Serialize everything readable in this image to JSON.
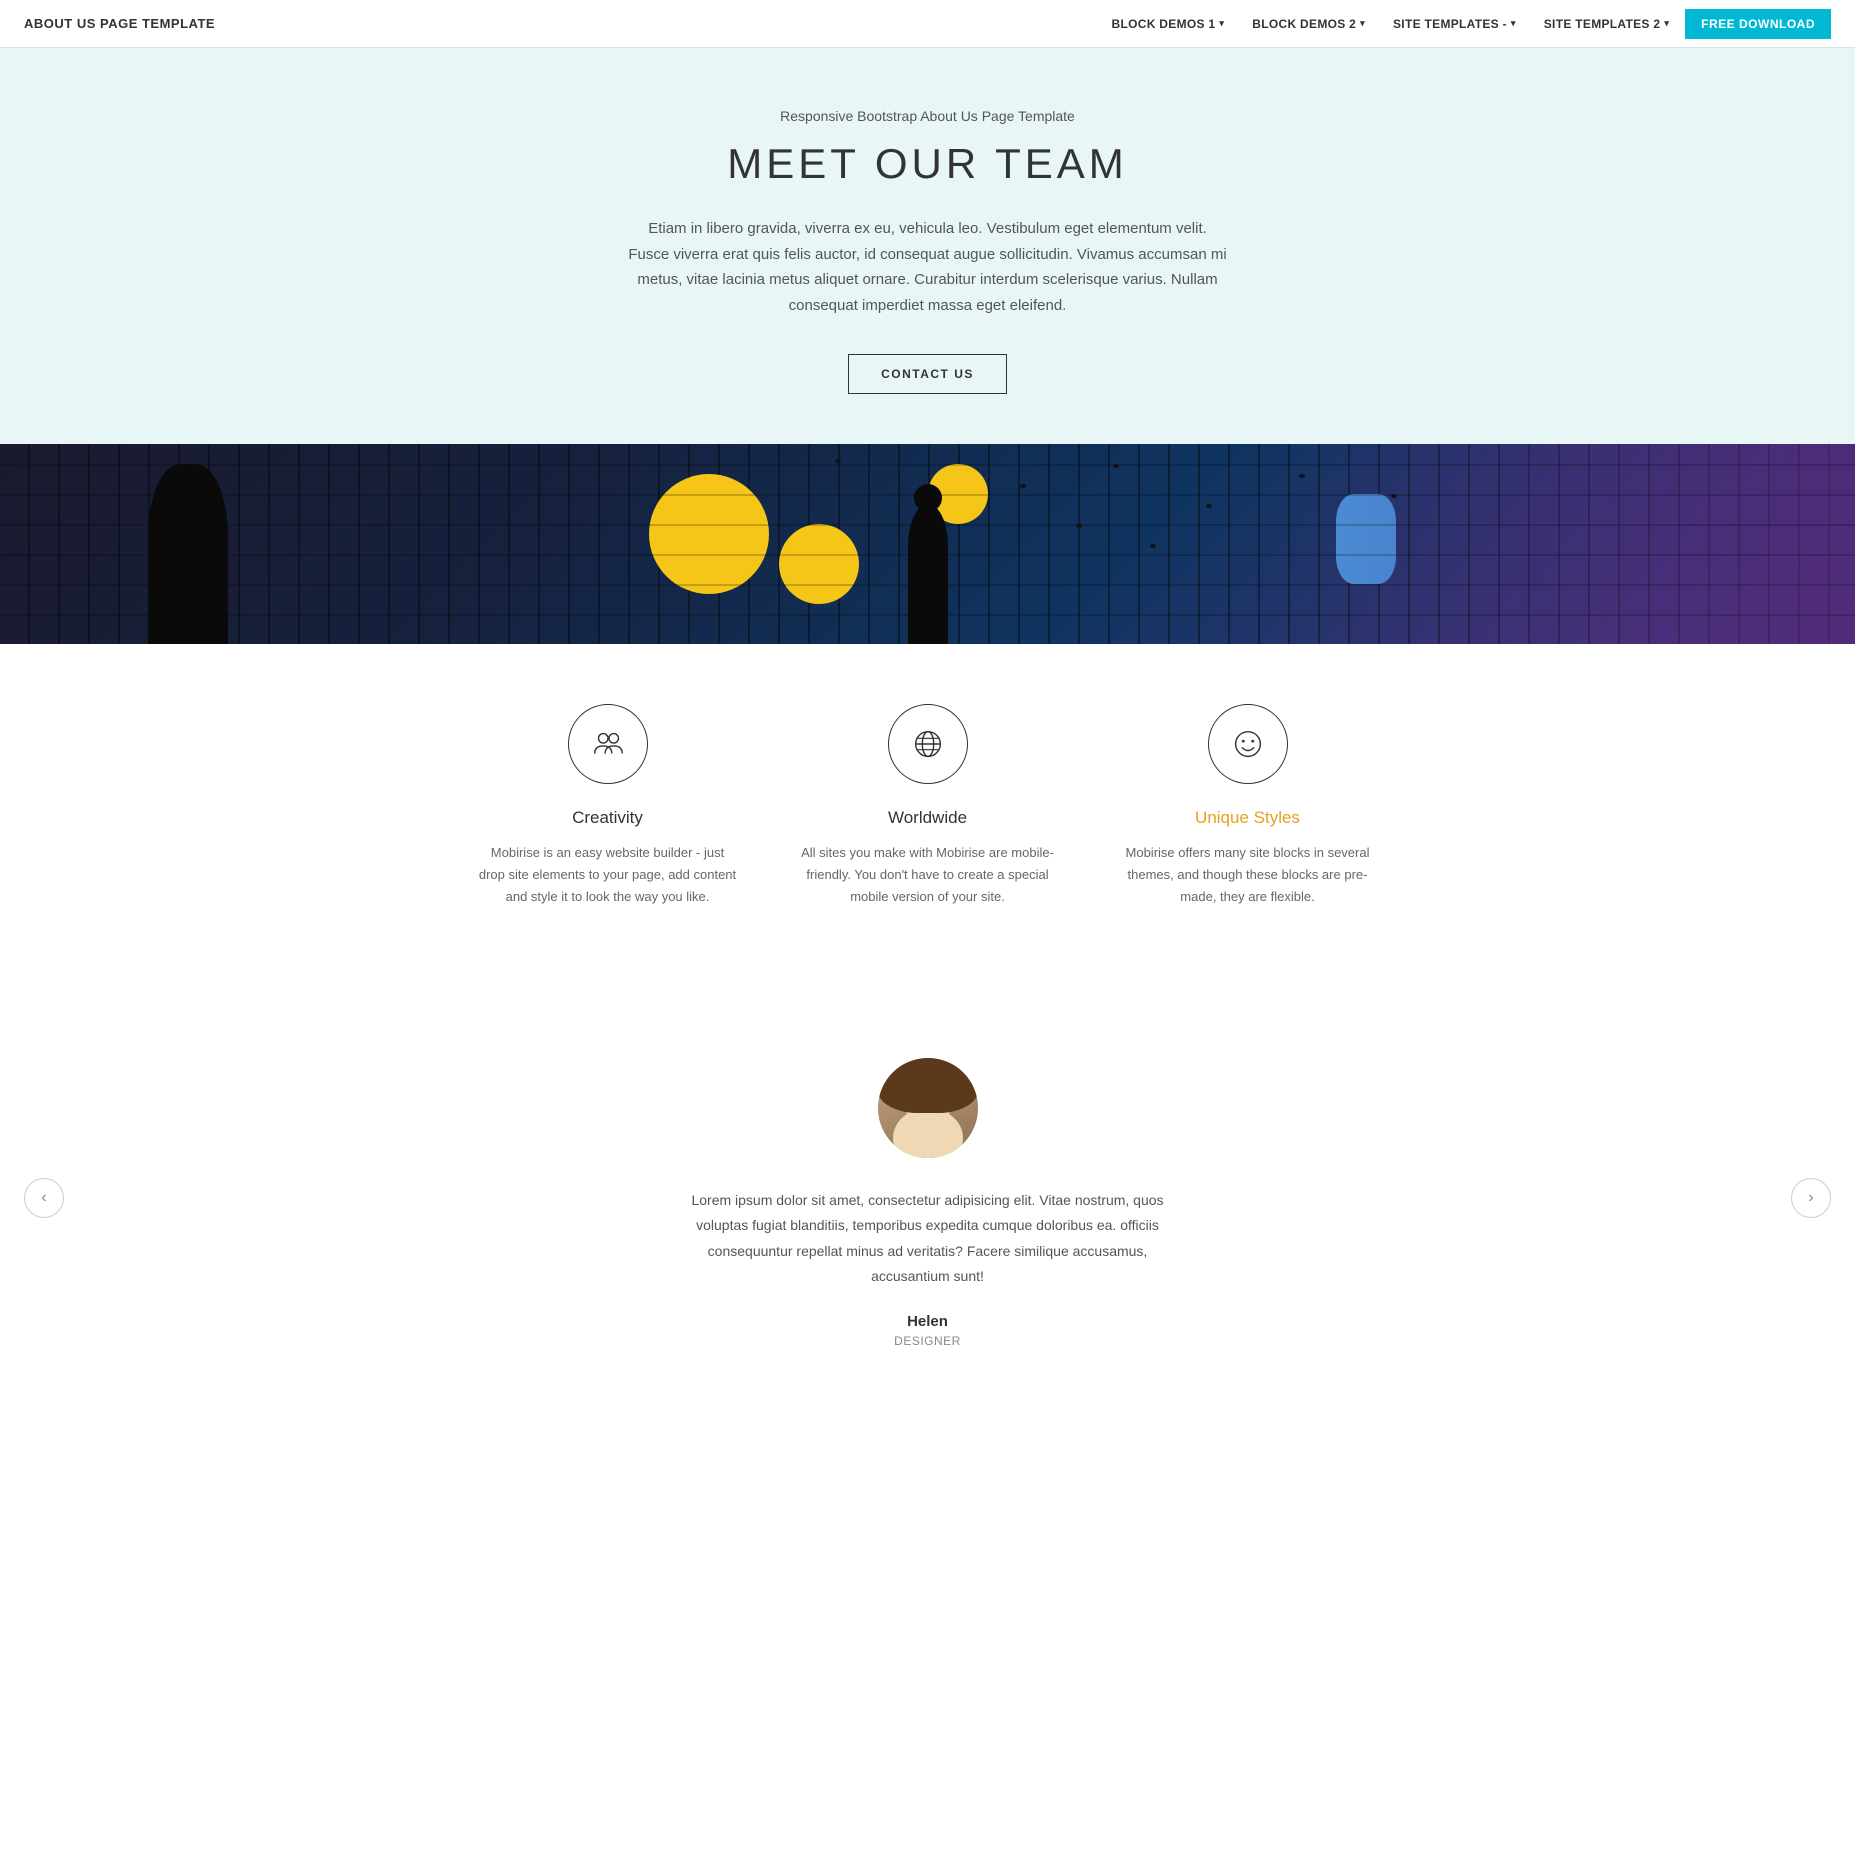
{
  "navbar": {
    "brand": "ABOUT US PAGE TEMPLATE",
    "nav_items": [
      {
        "label": "BLOCK DEMOS 1",
        "dropdown": true
      },
      {
        "label": "BLOCK DEMOS 2",
        "dropdown": true
      },
      {
        "label": "SITE TEMPLATES -",
        "dropdown": true
      },
      {
        "label": "SITE TEMPLATES 2",
        "dropdown": true
      }
    ],
    "cta_label": "FREE DOWNLOAD"
  },
  "hero": {
    "subtitle": "Responsive Bootstrap About Us Page Template",
    "title": "MEET OUR TEAM",
    "description": "Etiam in libero gravida, viverra ex eu, vehicula leo. Vestibulum eget elementum velit. Fusce viverra erat quis felis auctor, id consequat augue sollicitudin. Vivamus accumsan mi metus, vitae lacinia metus aliquet ornare. Curabitur interdum scelerisque varius. Nullam consequat imperdiet massa eget eleifend.",
    "cta_label": "CONTACT US"
  },
  "features": {
    "items": [
      {
        "id": "creativity",
        "title": "Creativity",
        "title_highlight": false,
        "description": "Mobirise is an easy website builder - just drop site elements to your page, add content and style it to look the way you like.",
        "icon": "creativity"
      },
      {
        "id": "worldwide",
        "title": "Worldwide",
        "title_highlight": false,
        "description": "All sites you make with Mobirise are mobile-friendly. You don't have to create a special mobile version of your site.",
        "icon": "worldwide"
      },
      {
        "id": "unique-styles",
        "title": "Unique Styles",
        "title_highlight": true,
        "description": "Mobirise offers many site blocks in several themes, and though these blocks are pre-made, they are flexible.",
        "icon": "smiley"
      }
    ]
  },
  "testimonial": {
    "text": "Lorem ipsum dolor sit amet, consectetur adipisicing elit. Vitae nostrum, quos voluptas fugiat blanditiis, temporibus expedita cumque doloribus ea. officiis consequuntur repellat minus ad veritatis? Facere similique accusamus, accusantium sunt!",
    "name": "Helen",
    "role": "DESIGNER",
    "prev_label": "‹",
    "next_label": "›"
  }
}
